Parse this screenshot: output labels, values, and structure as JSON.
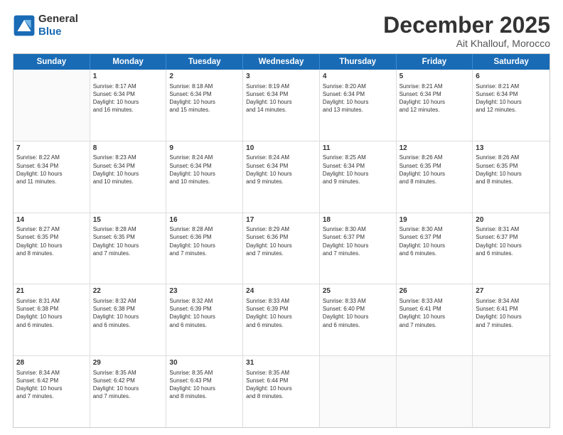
{
  "header": {
    "logo_line1": "General",
    "logo_line2": "Blue",
    "month": "December 2025",
    "location": "Ait Khallouf, Morocco"
  },
  "weekdays": [
    "Sunday",
    "Monday",
    "Tuesday",
    "Wednesday",
    "Thursday",
    "Friday",
    "Saturday"
  ],
  "rows": [
    [
      {
        "day": "",
        "text": ""
      },
      {
        "day": "1",
        "text": "Sunrise: 8:17 AM\nSunset: 6:34 PM\nDaylight: 10 hours\nand 16 minutes."
      },
      {
        "day": "2",
        "text": "Sunrise: 8:18 AM\nSunset: 6:34 PM\nDaylight: 10 hours\nand 15 minutes."
      },
      {
        "day": "3",
        "text": "Sunrise: 8:19 AM\nSunset: 6:34 PM\nDaylight: 10 hours\nand 14 minutes."
      },
      {
        "day": "4",
        "text": "Sunrise: 8:20 AM\nSunset: 6:34 PM\nDaylight: 10 hours\nand 13 minutes."
      },
      {
        "day": "5",
        "text": "Sunrise: 8:21 AM\nSunset: 6:34 PM\nDaylight: 10 hours\nand 12 minutes."
      },
      {
        "day": "6",
        "text": "Sunrise: 8:21 AM\nSunset: 6:34 PM\nDaylight: 10 hours\nand 12 minutes."
      }
    ],
    [
      {
        "day": "7",
        "text": "Sunrise: 8:22 AM\nSunset: 6:34 PM\nDaylight: 10 hours\nand 11 minutes."
      },
      {
        "day": "8",
        "text": "Sunrise: 8:23 AM\nSunset: 6:34 PM\nDaylight: 10 hours\nand 10 minutes."
      },
      {
        "day": "9",
        "text": "Sunrise: 8:24 AM\nSunset: 6:34 PM\nDaylight: 10 hours\nand 10 minutes."
      },
      {
        "day": "10",
        "text": "Sunrise: 8:24 AM\nSunset: 6:34 PM\nDaylight: 10 hours\nand 9 minutes."
      },
      {
        "day": "11",
        "text": "Sunrise: 8:25 AM\nSunset: 6:34 PM\nDaylight: 10 hours\nand 9 minutes."
      },
      {
        "day": "12",
        "text": "Sunrise: 8:26 AM\nSunset: 6:35 PM\nDaylight: 10 hours\nand 8 minutes."
      },
      {
        "day": "13",
        "text": "Sunrise: 8:26 AM\nSunset: 6:35 PM\nDaylight: 10 hours\nand 8 minutes."
      }
    ],
    [
      {
        "day": "14",
        "text": "Sunrise: 8:27 AM\nSunset: 6:35 PM\nDaylight: 10 hours\nand 8 minutes."
      },
      {
        "day": "15",
        "text": "Sunrise: 8:28 AM\nSunset: 6:35 PM\nDaylight: 10 hours\nand 7 minutes."
      },
      {
        "day": "16",
        "text": "Sunrise: 8:28 AM\nSunset: 6:36 PM\nDaylight: 10 hours\nand 7 minutes."
      },
      {
        "day": "17",
        "text": "Sunrise: 8:29 AM\nSunset: 6:36 PM\nDaylight: 10 hours\nand 7 minutes."
      },
      {
        "day": "18",
        "text": "Sunrise: 8:30 AM\nSunset: 6:37 PM\nDaylight: 10 hours\nand 7 minutes."
      },
      {
        "day": "19",
        "text": "Sunrise: 8:30 AM\nSunset: 6:37 PM\nDaylight: 10 hours\nand 6 minutes."
      },
      {
        "day": "20",
        "text": "Sunrise: 8:31 AM\nSunset: 6:37 PM\nDaylight: 10 hours\nand 6 minutes."
      }
    ],
    [
      {
        "day": "21",
        "text": "Sunrise: 8:31 AM\nSunset: 6:38 PM\nDaylight: 10 hours\nand 6 minutes."
      },
      {
        "day": "22",
        "text": "Sunrise: 8:32 AM\nSunset: 6:38 PM\nDaylight: 10 hours\nand 6 minutes."
      },
      {
        "day": "23",
        "text": "Sunrise: 8:32 AM\nSunset: 6:39 PM\nDaylight: 10 hours\nand 6 minutes."
      },
      {
        "day": "24",
        "text": "Sunrise: 8:33 AM\nSunset: 6:39 PM\nDaylight: 10 hours\nand 6 minutes."
      },
      {
        "day": "25",
        "text": "Sunrise: 8:33 AM\nSunset: 6:40 PM\nDaylight: 10 hours\nand 6 minutes."
      },
      {
        "day": "26",
        "text": "Sunrise: 8:33 AM\nSunset: 6:41 PM\nDaylight: 10 hours\nand 7 minutes."
      },
      {
        "day": "27",
        "text": "Sunrise: 8:34 AM\nSunset: 6:41 PM\nDaylight: 10 hours\nand 7 minutes."
      }
    ],
    [
      {
        "day": "28",
        "text": "Sunrise: 8:34 AM\nSunset: 6:42 PM\nDaylight: 10 hours\nand 7 minutes."
      },
      {
        "day": "29",
        "text": "Sunrise: 8:35 AM\nSunset: 6:42 PM\nDaylight: 10 hours\nand 7 minutes."
      },
      {
        "day": "30",
        "text": "Sunrise: 8:35 AM\nSunset: 6:43 PM\nDaylight: 10 hours\nand 8 minutes."
      },
      {
        "day": "31",
        "text": "Sunrise: 8:35 AM\nSunset: 6:44 PM\nDaylight: 10 hours\nand 8 minutes."
      },
      {
        "day": "",
        "text": ""
      },
      {
        "day": "",
        "text": ""
      },
      {
        "day": "",
        "text": ""
      }
    ]
  ]
}
